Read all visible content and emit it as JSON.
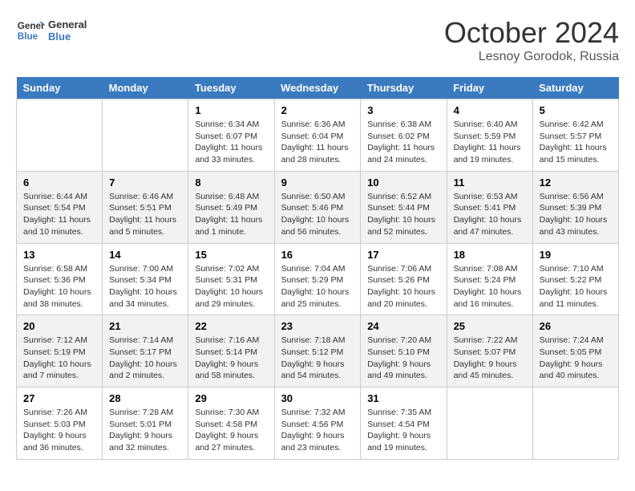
{
  "header": {
    "logo_line1": "General",
    "logo_line2": "Blue",
    "month": "October 2024",
    "location": "Lesnoy Gorodok, Russia"
  },
  "weekdays": [
    "Sunday",
    "Monday",
    "Tuesday",
    "Wednesday",
    "Thursday",
    "Friday",
    "Saturday"
  ],
  "weeks": [
    [
      {
        "day": "",
        "sunrise": "",
        "sunset": "",
        "daylight": ""
      },
      {
        "day": "",
        "sunrise": "",
        "sunset": "",
        "daylight": ""
      },
      {
        "day": "1",
        "sunrise": "Sunrise: 6:34 AM",
        "sunset": "Sunset: 6:07 PM",
        "daylight": "Daylight: 11 hours and 33 minutes."
      },
      {
        "day": "2",
        "sunrise": "Sunrise: 6:36 AM",
        "sunset": "Sunset: 6:04 PM",
        "daylight": "Daylight: 11 hours and 28 minutes."
      },
      {
        "day": "3",
        "sunrise": "Sunrise: 6:38 AM",
        "sunset": "Sunset: 6:02 PM",
        "daylight": "Daylight: 11 hours and 24 minutes."
      },
      {
        "day": "4",
        "sunrise": "Sunrise: 6:40 AM",
        "sunset": "Sunset: 5:59 PM",
        "daylight": "Daylight: 11 hours and 19 minutes."
      },
      {
        "day": "5",
        "sunrise": "Sunrise: 6:42 AM",
        "sunset": "Sunset: 5:57 PM",
        "daylight": "Daylight: 11 hours and 15 minutes."
      }
    ],
    [
      {
        "day": "6",
        "sunrise": "Sunrise: 6:44 AM",
        "sunset": "Sunset: 5:54 PM",
        "daylight": "Daylight: 11 hours and 10 minutes."
      },
      {
        "day": "7",
        "sunrise": "Sunrise: 6:46 AM",
        "sunset": "Sunset: 5:51 PM",
        "daylight": "Daylight: 11 hours and 5 minutes."
      },
      {
        "day": "8",
        "sunrise": "Sunrise: 6:48 AM",
        "sunset": "Sunset: 5:49 PM",
        "daylight": "Daylight: 11 hours and 1 minute."
      },
      {
        "day": "9",
        "sunrise": "Sunrise: 6:50 AM",
        "sunset": "Sunset: 5:46 PM",
        "daylight": "Daylight: 10 hours and 56 minutes."
      },
      {
        "day": "10",
        "sunrise": "Sunrise: 6:52 AM",
        "sunset": "Sunset: 5:44 PM",
        "daylight": "Daylight: 10 hours and 52 minutes."
      },
      {
        "day": "11",
        "sunrise": "Sunrise: 6:53 AM",
        "sunset": "Sunset: 5:41 PM",
        "daylight": "Daylight: 10 hours and 47 minutes."
      },
      {
        "day": "12",
        "sunrise": "Sunrise: 6:56 AM",
        "sunset": "Sunset: 5:39 PM",
        "daylight": "Daylight: 10 hours and 43 minutes."
      }
    ],
    [
      {
        "day": "13",
        "sunrise": "Sunrise: 6:58 AM",
        "sunset": "Sunset: 5:36 PM",
        "daylight": "Daylight: 10 hours and 38 minutes."
      },
      {
        "day": "14",
        "sunrise": "Sunrise: 7:00 AM",
        "sunset": "Sunset: 5:34 PM",
        "daylight": "Daylight: 10 hours and 34 minutes."
      },
      {
        "day": "15",
        "sunrise": "Sunrise: 7:02 AM",
        "sunset": "Sunset: 5:31 PM",
        "daylight": "Daylight: 10 hours and 29 minutes."
      },
      {
        "day": "16",
        "sunrise": "Sunrise: 7:04 AM",
        "sunset": "Sunset: 5:29 PM",
        "daylight": "Daylight: 10 hours and 25 minutes."
      },
      {
        "day": "17",
        "sunrise": "Sunrise: 7:06 AM",
        "sunset": "Sunset: 5:26 PM",
        "daylight": "Daylight: 10 hours and 20 minutes."
      },
      {
        "day": "18",
        "sunrise": "Sunrise: 7:08 AM",
        "sunset": "Sunset: 5:24 PM",
        "daylight": "Daylight: 10 hours and 16 minutes."
      },
      {
        "day": "19",
        "sunrise": "Sunrise: 7:10 AM",
        "sunset": "Sunset: 5:22 PM",
        "daylight": "Daylight: 10 hours and 11 minutes."
      }
    ],
    [
      {
        "day": "20",
        "sunrise": "Sunrise: 7:12 AM",
        "sunset": "Sunset: 5:19 PM",
        "daylight": "Daylight: 10 hours and 7 minutes."
      },
      {
        "day": "21",
        "sunrise": "Sunrise: 7:14 AM",
        "sunset": "Sunset: 5:17 PM",
        "daylight": "Daylight: 10 hours and 2 minutes."
      },
      {
        "day": "22",
        "sunrise": "Sunrise: 7:16 AM",
        "sunset": "Sunset: 5:14 PM",
        "daylight": "Daylight: 9 hours and 58 minutes."
      },
      {
        "day": "23",
        "sunrise": "Sunrise: 7:18 AM",
        "sunset": "Sunset: 5:12 PM",
        "daylight": "Daylight: 9 hours and 54 minutes."
      },
      {
        "day": "24",
        "sunrise": "Sunrise: 7:20 AM",
        "sunset": "Sunset: 5:10 PM",
        "daylight": "Daylight: 9 hours and 49 minutes."
      },
      {
        "day": "25",
        "sunrise": "Sunrise: 7:22 AM",
        "sunset": "Sunset: 5:07 PM",
        "daylight": "Daylight: 9 hours and 45 minutes."
      },
      {
        "day": "26",
        "sunrise": "Sunrise: 7:24 AM",
        "sunset": "Sunset: 5:05 PM",
        "daylight": "Daylight: 9 hours and 40 minutes."
      }
    ],
    [
      {
        "day": "27",
        "sunrise": "Sunrise: 7:26 AM",
        "sunset": "Sunset: 5:03 PM",
        "daylight": "Daylight: 9 hours and 36 minutes."
      },
      {
        "day": "28",
        "sunrise": "Sunrise: 7:28 AM",
        "sunset": "Sunset: 5:01 PM",
        "daylight": "Daylight: 9 hours and 32 minutes."
      },
      {
        "day": "29",
        "sunrise": "Sunrise: 7:30 AM",
        "sunset": "Sunset: 4:58 PM",
        "daylight": "Daylight: 9 hours and 27 minutes."
      },
      {
        "day": "30",
        "sunrise": "Sunrise: 7:32 AM",
        "sunset": "Sunset: 4:56 PM",
        "daylight": "Daylight: 9 hours and 23 minutes."
      },
      {
        "day": "31",
        "sunrise": "Sunrise: 7:35 AM",
        "sunset": "Sunset: 4:54 PM",
        "daylight": "Daylight: 9 hours and 19 minutes."
      },
      {
        "day": "",
        "sunrise": "",
        "sunset": "",
        "daylight": ""
      },
      {
        "day": "",
        "sunrise": "",
        "sunset": "",
        "daylight": ""
      }
    ]
  ]
}
